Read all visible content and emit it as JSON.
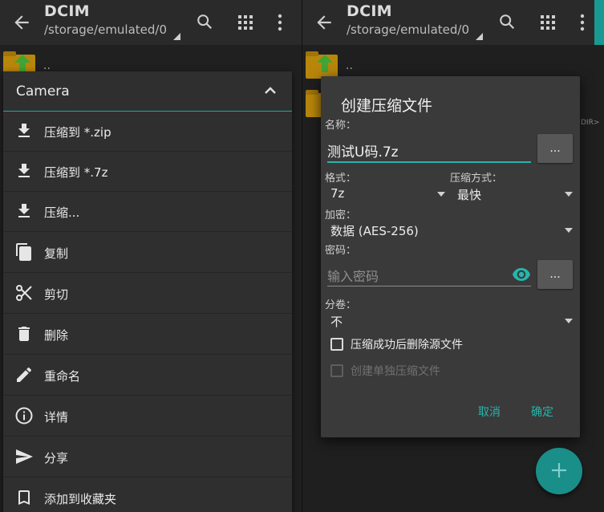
{
  "left_pane": {
    "appbar": {
      "title": "DCIM",
      "path": "/storage/emulated/0"
    },
    "parent_label": ".."
  },
  "right_pane": {
    "appbar": {
      "title": "DCIM",
      "path": "/storage/emulated/0"
    },
    "parent_label": "..",
    "dir_tag": "DIR>"
  },
  "context_menu": {
    "header": "Camera",
    "items": [
      {
        "label": "压缩到 *.zip",
        "icon": "download-icon"
      },
      {
        "label": "压缩到 *.7z",
        "icon": "download-icon"
      },
      {
        "label": "压缩...",
        "icon": "download-icon"
      },
      {
        "label": "复制",
        "icon": "copy-icon"
      },
      {
        "label": "剪切",
        "icon": "scissors-icon"
      },
      {
        "label": "删除",
        "icon": "trash-icon"
      },
      {
        "label": "重命名",
        "icon": "pencil-icon"
      },
      {
        "label": "详情",
        "icon": "info-icon"
      },
      {
        "label": "分享",
        "icon": "send-icon"
      },
      {
        "label": "添加到收藏夹",
        "icon": "bookmark-icon"
      }
    ]
  },
  "dialog": {
    "title": "创建压缩文件",
    "name_label": "名称：",
    "name_value": "测试U码.7z",
    "browse_label": "...",
    "format_label": "格式：",
    "format_value": "7z",
    "method_label": "压缩方式：",
    "method_value": "最快",
    "encrypt_label": "加密：",
    "encrypt_value": "数据 (AES-256)",
    "password_label": "密码：",
    "password_placeholder": "输入密码",
    "volume_label": "分卷：",
    "volume_value": "不",
    "delete_source_label": "压缩成功后删除源文件",
    "separate_label": "创建单独压缩文件",
    "cancel_label": "取消",
    "ok_label": "确定"
  },
  "fab_label": "+",
  "colors": {
    "accent": "#26b5ad",
    "fab": "#1a8e89",
    "folder": "#b8860b",
    "arrow": "#3fa535"
  }
}
